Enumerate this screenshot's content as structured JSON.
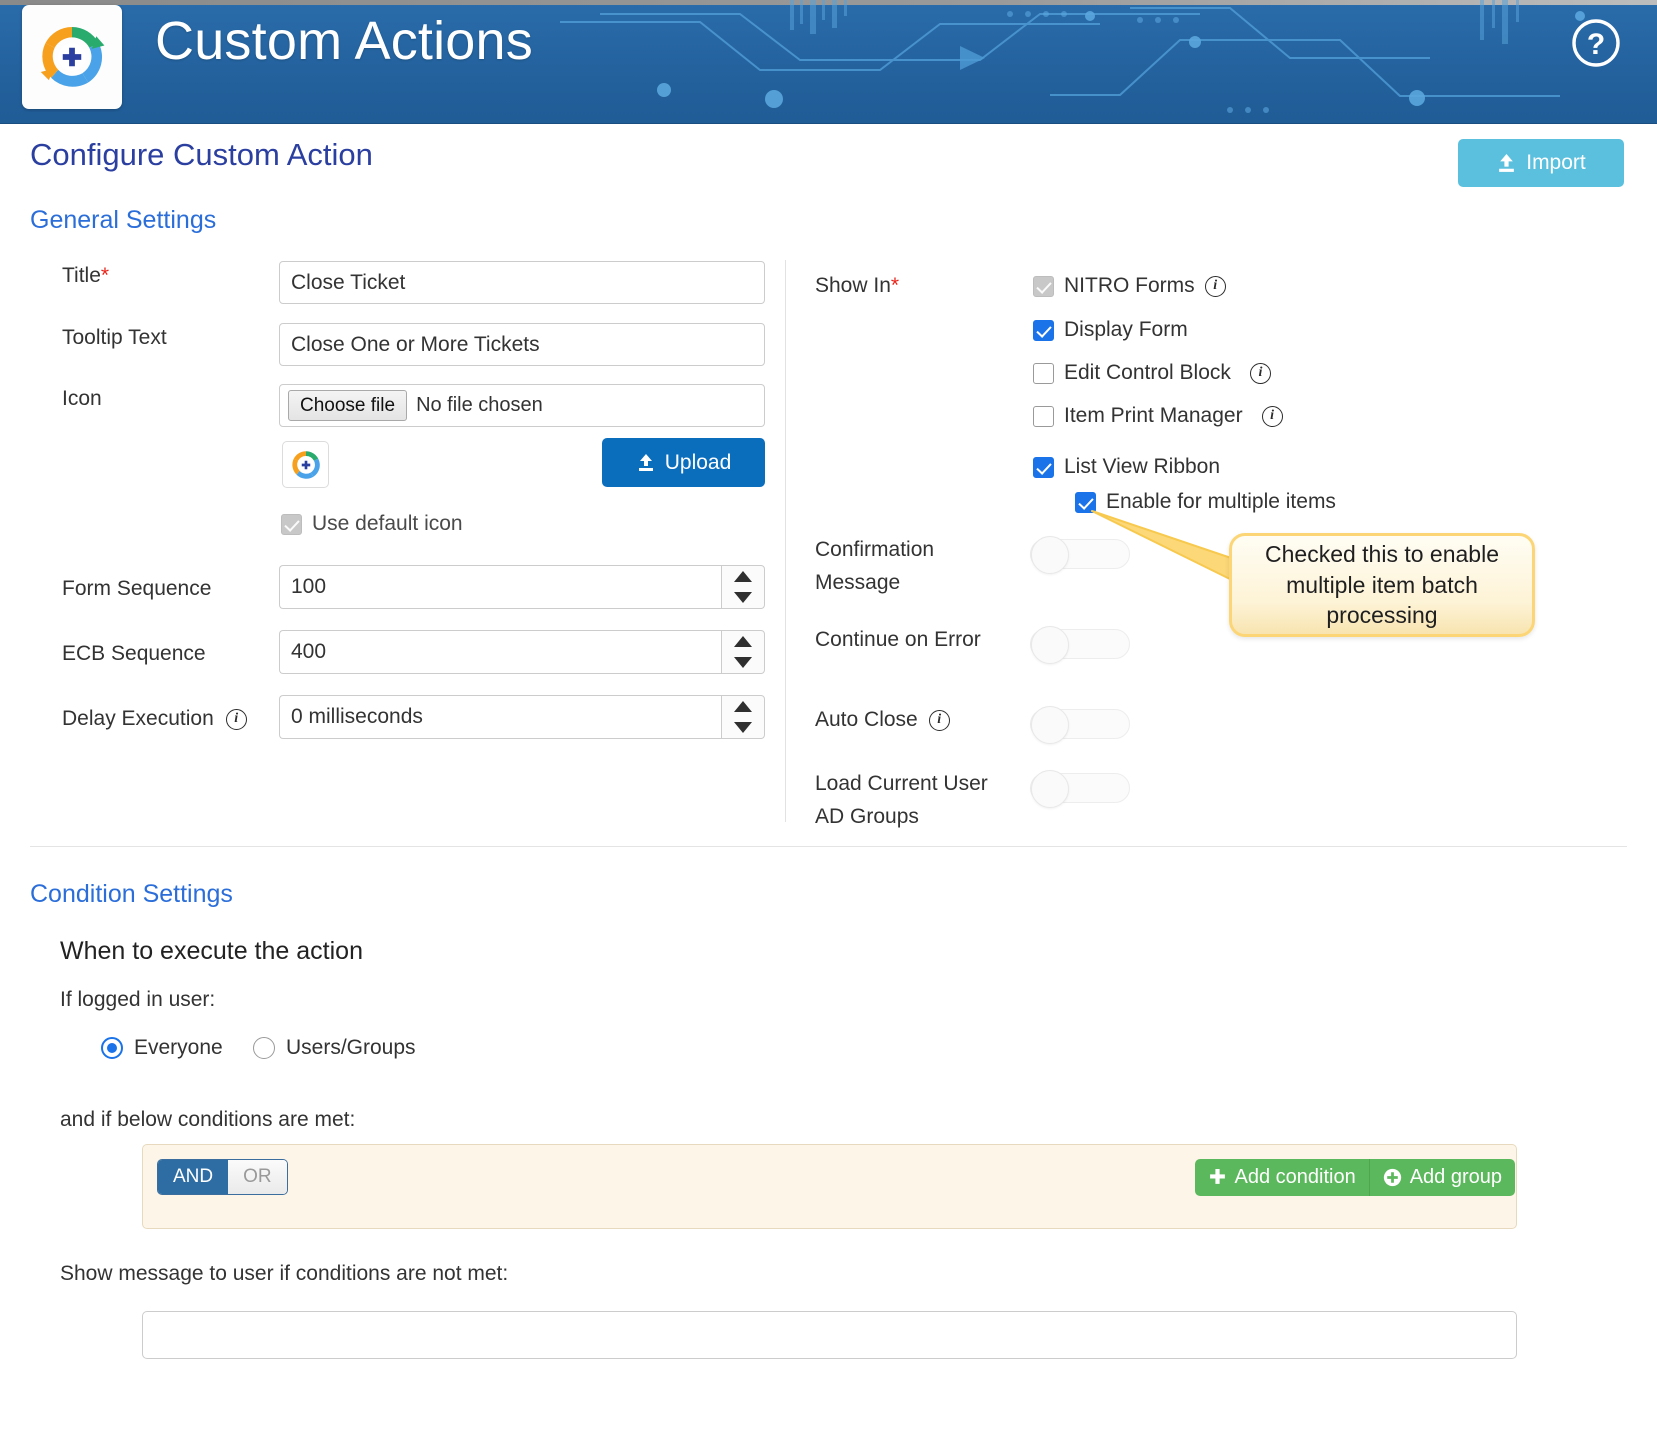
{
  "banner": {
    "title": "Custom Actions",
    "logo_icon": "nitro-refresh-plus-logo",
    "help_icon": "help-circle-icon",
    "bg_color": "#24639f"
  },
  "header": {
    "page_title": "Configure Custom Action",
    "import_label": "Import",
    "import_icon": "upload-icon",
    "import_color": "#5bc0de"
  },
  "general_settings": {
    "heading": "General Settings",
    "title_label": "Title",
    "title_required": "*",
    "title_value": "Close Ticket",
    "tooltip_label": "Tooltip Text",
    "tooltip_value": "Close One or More Tickets",
    "icon_label": "Icon",
    "choose_file_label": "Choose file",
    "file_status": "No file chosen",
    "icon_preview_name": "nitro-refresh-plus-logo",
    "upload_label": "Upload",
    "upload_icon": "upload-icon",
    "use_default_icon_label": "Use default icon",
    "use_default_icon_checked": true,
    "use_default_icon_disabled": true,
    "form_sequence_label": "Form Sequence",
    "form_sequence_value": "100",
    "ecb_sequence_label": "ECB Sequence",
    "ecb_sequence_value": "400",
    "delay_execution_label": "Delay Execution",
    "delay_execution_value": "0 milliseconds",
    "info_icon": "info-circle-icon"
  },
  "show_in": {
    "label": "Show In",
    "required": "*",
    "options": [
      {
        "label": "NITRO Forms",
        "checked": true,
        "disabled": true,
        "info": true
      },
      {
        "label": "Display Form",
        "checked": true,
        "disabled": false,
        "info": false
      },
      {
        "label": "Edit Control Block",
        "checked": false,
        "disabled": false,
        "info": true
      },
      {
        "label": "Item Print Manager",
        "checked": false,
        "disabled": false,
        "info": true
      },
      {
        "label": "List View Ribbon",
        "checked": true,
        "disabled": false,
        "info": false
      }
    ],
    "sub_option": {
      "label": "Enable for multiple items",
      "checked": true
    }
  },
  "toggles": [
    {
      "label_line1": "Confirmation",
      "label_line2": "Message",
      "on": false,
      "info": false
    },
    {
      "label_line1": "Continue on Error",
      "label_line2": "",
      "on": false,
      "info": false
    },
    {
      "label_line1": "Auto Close",
      "label_line2": "",
      "on": false,
      "info": true
    },
    {
      "label_line1": "Load Current User",
      "label_line2": "AD Groups",
      "on": false,
      "info": false
    }
  ],
  "callout": {
    "text": "Checked this to enable multiple item batch processing",
    "border_color": "#fcd676",
    "fill_color": "#fdf3d6"
  },
  "condition_settings": {
    "heading": "Condition Settings",
    "sub_heading": "When to execute the action",
    "if_logged_label": "If logged in user:",
    "radio_options": [
      {
        "label": "Everyone",
        "selected": true
      },
      {
        "label": "Users/Groups",
        "selected": false
      }
    ],
    "conditions_label": "and if below conditions are met:",
    "logic": {
      "and_label": "AND",
      "or_label": "OR",
      "selected": "AND"
    },
    "add_condition_label": "Add condition",
    "add_condition_icon": "plus-icon",
    "add_group_label": "Add group",
    "add_group_icon": "plus-circle-icon",
    "message_label": "Show message to user if conditions are not met:",
    "message_value": "",
    "message_placeholder": ""
  }
}
